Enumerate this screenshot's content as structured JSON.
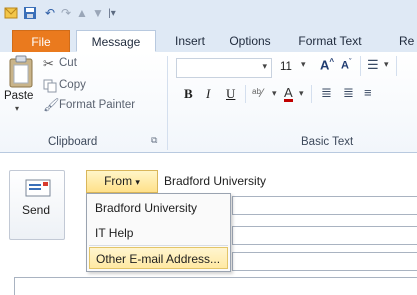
{
  "tabs": [
    "File",
    "Message",
    "Insert",
    "Options",
    "Format Text",
    "Re"
  ],
  "clipboard": {
    "paste_label": "Paste",
    "cut_label": "Cut",
    "copy_label": "Copy",
    "format_painter_label": "Format Painter",
    "group_label": "Clipboard"
  },
  "basic_text": {
    "font_size": "11",
    "bold": "B",
    "italic": "I",
    "underline": "U",
    "font_color_glyph": "A",
    "group_label": "Basic Text"
  },
  "compose": {
    "send_label": "Send",
    "from_label": "From",
    "from_value": "Bradford University"
  },
  "from_menu": {
    "items": [
      "Bradford University",
      "IT Help",
      "Other E-mail Address..."
    ]
  },
  "colors": {
    "file_tab": "#ea7a1e",
    "from_button": "#ffe18a",
    "menu_highlight": "#ffe9a3"
  }
}
